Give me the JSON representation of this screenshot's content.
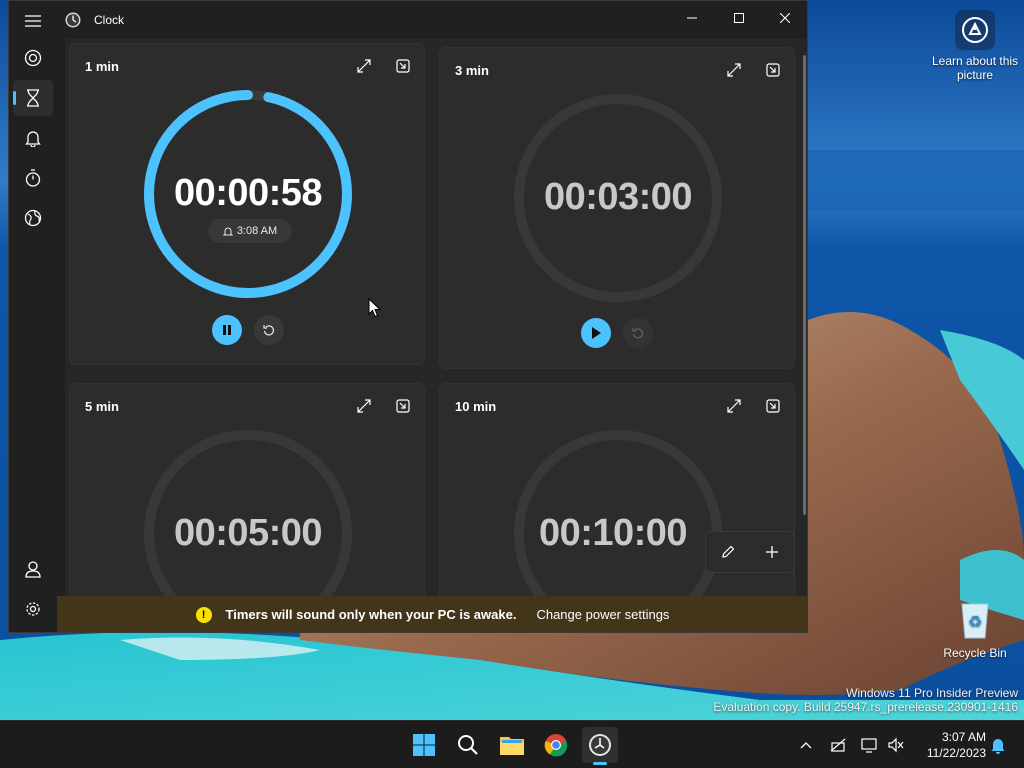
{
  "desktop": {
    "learn_label": "Learn about this picture",
    "recycle_label": "Recycle Bin",
    "watermark_line1": "Windows 11 Pro Insider Preview",
    "watermark_line2": "Evaluation copy. Build 25947.rs_prerelease.230901-1416"
  },
  "window": {
    "title": "Clock",
    "nav_items": [
      "focus-sessions",
      "timer",
      "alarm",
      "stopwatch",
      "world-clock"
    ],
    "active_nav": "timer"
  },
  "timers": [
    {
      "label": "1 min",
      "time": "00:00:58",
      "state": "running",
      "alarm_time": "3:08 AM",
      "progress": 0.967
    },
    {
      "label": "3 min",
      "time": "00:03:00",
      "state": "idle",
      "progress": 0
    },
    {
      "label": "5 min",
      "time": "00:05:00",
      "state": "idle",
      "progress": 0
    },
    {
      "label": "10 min",
      "time": "00:10:00",
      "state": "idle",
      "progress": 0
    }
  ],
  "infobar": {
    "message": "Timers will sound only when your PC is awake.",
    "link": "Change power settings",
    "icon": "!"
  },
  "taskbar": {
    "time": "3:07 AM",
    "date": "11/22/2023"
  },
  "colors": {
    "accent": "#4cc2ff",
    "warning": "#fce100",
    "infobar_bg": "#433519"
  }
}
